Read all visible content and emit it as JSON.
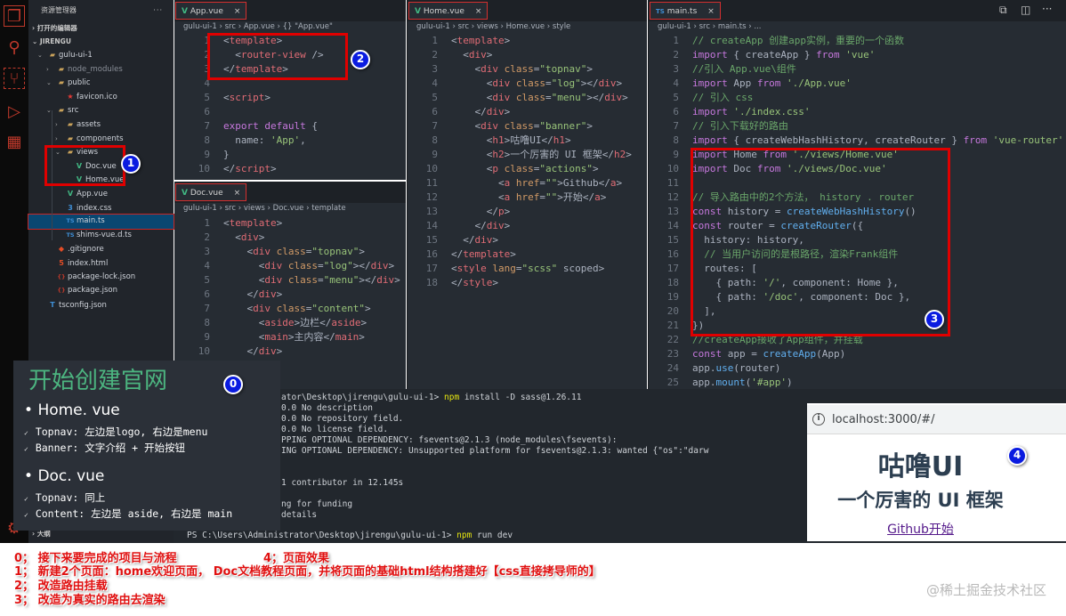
{
  "sidebar": {
    "title": "资源管理器",
    "more": "···",
    "open_editors": "打开的编辑器",
    "workspace": "JIRENGU",
    "outline": "大纲",
    "items": [
      {
        "label": "gulu-ui-1",
        "icon": "folder-icon",
        "depth": 1,
        "twisty": "v"
      },
      {
        "label": "node_modules",
        "icon": "folder-icon",
        "depth": 2,
        "twisty": ">",
        "dim": true
      },
      {
        "label": "public",
        "icon": "folder-icon",
        "depth": 2,
        "twisty": "v"
      },
      {
        "label": "favicon.ico",
        "icon": "favicon-icon",
        "depth": 3
      },
      {
        "label": "src",
        "icon": "folder-icon",
        "depth": 2,
        "twisty": "v"
      },
      {
        "label": "assets",
        "icon": "folder-icon",
        "depth": 3,
        "twisty": ">"
      },
      {
        "label": "components",
        "icon": "folder-icon",
        "depth": 3,
        "twisty": ">"
      },
      {
        "label": "views",
        "icon": "folder-icon",
        "depth": 3,
        "twisty": "v"
      },
      {
        "label": "Doc.vue",
        "icon": "vue-icon",
        "depth": 4
      },
      {
        "label": "Home.vue",
        "icon": "vue-icon",
        "depth": 4
      },
      {
        "label": "App.vue",
        "icon": "vue-icon",
        "depth": 3
      },
      {
        "label": "index.css",
        "icon": "css-icon",
        "depth": 3
      },
      {
        "label": "main.ts",
        "icon": "ts-icon",
        "depth": 3,
        "selected": true
      },
      {
        "label": "shims-vue.d.ts",
        "icon": "ts-icon",
        "depth": 3
      },
      {
        "label": ".gitignore",
        "icon": "git-icon",
        "depth": 2
      },
      {
        "label": "index.html",
        "icon": "html-icon",
        "depth": 2
      },
      {
        "label": "package-lock.json",
        "icon": "json-icon",
        "depth": 2
      },
      {
        "label": "package.json",
        "icon": "json-icon",
        "depth": 2
      },
      {
        "label": "tsconfig.json",
        "icon": "tsconfig-icon",
        "depth": 1
      }
    ]
  },
  "editors": {
    "app": {
      "tab": "App.vue",
      "close": "×",
      "breadcrumb": "gulu-ui-1 › src › App.vue › {} \"App.vue\"",
      "lines": [
        "<template>",
        "  <router-view />",
        "</template>",
        "",
        "<script>",
        "",
        "export default {",
        "  name: 'App',",
        "}",
        "</script>"
      ]
    },
    "doc": {
      "tab": "Doc.vue",
      "close": "×",
      "breadcrumb": "gulu-ui-1 › src › views › Doc.vue › template",
      "lines": [
        "<template>",
        "  <div>",
        "    <div class=\"topnav\">",
        "      <div class=\"log\"></div>",
        "      <div class=\"menu\"></div>",
        "    </div>",
        "    <div class=\"content\">",
        "      <aside>边栏</aside>",
        "      <main>主内容</main>",
        "    </div>",
        "  </div>"
      ]
    },
    "home": {
      "tab": "Home.vue",
      "close": "×",
      "breadcrumb": "gulu-ui-1 › src › views › Home.vue › style",
      "lines": [
        "<template>",
        "  <div>",
        "    <div class=\"topnav\">",
        "      <div class=\"log\"></div>",
        "      <div class=\"menu\"></div>",
        "    </div>",
        "    <div class=\"banner\">",
        "      <h1>咕噜UI</h1>",
        "      <h2>一个厉害的 UI 框架</h2>",
        "      <p class=\"actions\">",
        "        <a href=\"\">Github</a>",
        "        <a href=\"\">开始</a>",
        "      </p>",
        "    </div>",
        "  </div>",
        "</template>",
        "<style lang=\"scss\" scoped>",
        "</style>"
      ]
    },
    "main": {
      "tab": "main.ts",
      "close": "×",
      "breadcrumb": "gulu-ui-1 › src › main.ts › ...",
      "lines": [
        "// createApp 创建app实例，重要的一个函数",
        "import { createApp } from 'vue'",
        "//引入 App.vue\\组件",
        "import App from './App.vue'",
        "// 引入 css",
        "import './index.css'",
        "// 引入下载好的路由",
        "import { createWebHashHistory, createRouter } from 'vue-router'",
        "import Home from './views/Home.vue'",
        "import Doc from './views/Doc.vue'",
        "",
        "// 导入路由中的2个方法， history . router",
        "const history = createWebHashHistory()",
        "const router = createRouter({",
        "  history: history,",
        "  // 当用户访问的是根路径，渲染Frank组件",
        "  routes: [",
        "    { path: '/', component: Home },",
        "    { path: '/doc', component: Doc },",
        "  ],",
        "})",
        "//createApp接收了App组件，并挂载",
        "const app = createApp(App)",
        "app.use(router)",
        "app.mount('#app')"
      ]
    }
  },
  "terminal": {
    "lines": [
      {
        "pre": "ator\\Desktop\\jirengu\\gulu-ui-1> ",
        "npm": "npm",
        "post": " install -D sass@1.26.11"
      },
      {
        "pre": "0.0 No description"
      },
      {
        "pre": "0.0 No repository field."
      },
      {
        "pre": "0.0 No license field."
      },
      {
        "pre": "PPING OPTIONAL DEPENDENCY: fsevents@2.1.3 (node_modules\\fsevents):"
      },
      {
        "pre": "ING OPTIONAL DEPENDENCY: Unsupported platform for fsevents@2.1.3: wanted {\"os\":\"darw"
      },
      {
        "pre": ""
      },
      {
        "pre": ""
      },
      {
        "pre": "1 contributor in 12.145s"
      },
      {
        "pre": ""
      },
      {
        "pre": "ng for funding"
      },
      {
        "pre": "details"
      }
    ],
    "prompt": {
      "pre": "PS C:\\Users\\Administrator\\Desktop\\jirengu\\gulu-ui-1> ",
      "npm": "npm",
      "post": " run dev"
    }
  },
  "slide": {
    "title": "开始创建官网",
    "bullets": [
      {
        "label": "Home. vue",
        "subs": [
          "Topnav: 左边是logo, 右边是menu",
          "Banner: 文字介绍 + 开始按钮"
        ]
      },
      {
        "label": "Doc. vue",
        "subs": [
          "Topnav: 同上",
          "Content: 左边是 aside, 右边是 main"
        ]
      }
    ],
    "check": "✓",
    "bullet": "•"
  },
  "browser": {
    "url": "localhost:3000/#/",
    "h1": "咕噜UI",
    "h2": "一个厉害的 UI 框架",
    "link": "Github开始"
  },
  "badges": [
    "0",
    "1",
    "2",
    "3",
    "4"
  ],
  "notes": {
    "n0": "0； 接下来要完成的项目与流程",
    "n4": "4；页面效果",
    "n1": "1； 新建2个页面：home欢迎页面， Doc文档教程页面，并将页面的基础html结构搭建好【css直接拷导师的】",
    "n2": "2； 改造路由挂载",
    "n3": "3； 改造为真实的路由去渲染"
  },
  "watermark": "@稀土掘金技术社区",
  "colors": {
    "accent": "#e00000",
    "badge": "#0a1be0",
    "editor_bg": "#262c33"
  }
}
